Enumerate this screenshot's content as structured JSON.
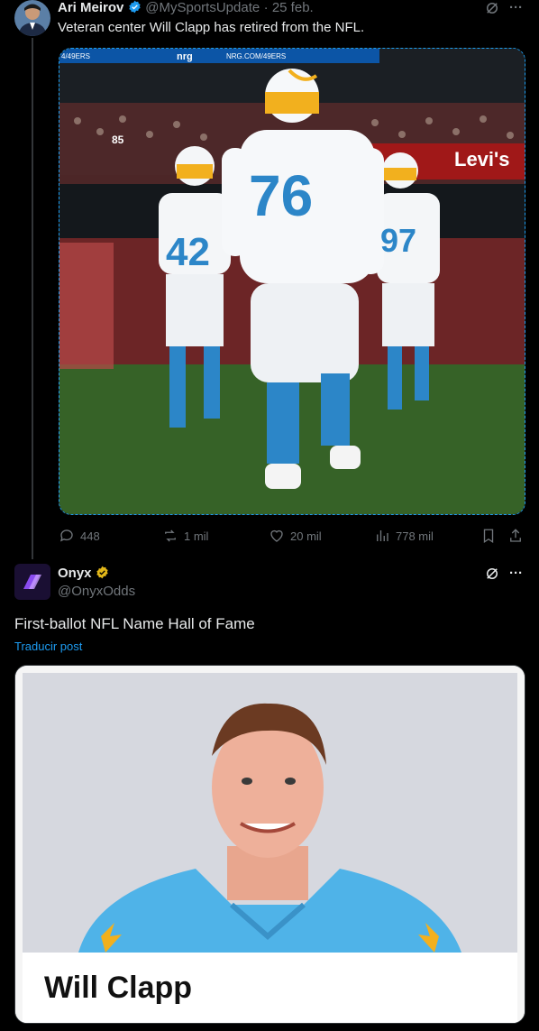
{
  "tweet1": {
    "author_name": "Ari Meirov",
    "handle": "@MySportsUpdate",
    "date": "· 25 feb.",
    "text": "Veteran center Will Clapp has retired from the NFL.",
    "photo": {
      "banner_left": "4/49ERS",
      "banner_mid": "nrg",
      "banner_right": "NRG.COM/49ERS",
      "stadium_sign": "Levi's",
      "jersey_numbers": [
        "76",
        "42",
        "97",
        "85"
      ]
    },
    "actions": {
      "replies": "448",
      "retweets": "1 mil",
      "likes": "20 mil",
      "views": "778 mil"
    }
  },
  "tweet2": {
    "author_name": "Onyx",
    "handle": "@OnyxOdds",
    "text": "First-ballot NFL Name Hall of Fame",
    "translate": "Traducir post",
    "photo_caption": "Will Clapp"
  },
  "colors": {
    "accent": "#1d9bf0",
    "verified_gold": "#e2b719",
    "chargers_blue": "#4fb3e8"
  }
}
